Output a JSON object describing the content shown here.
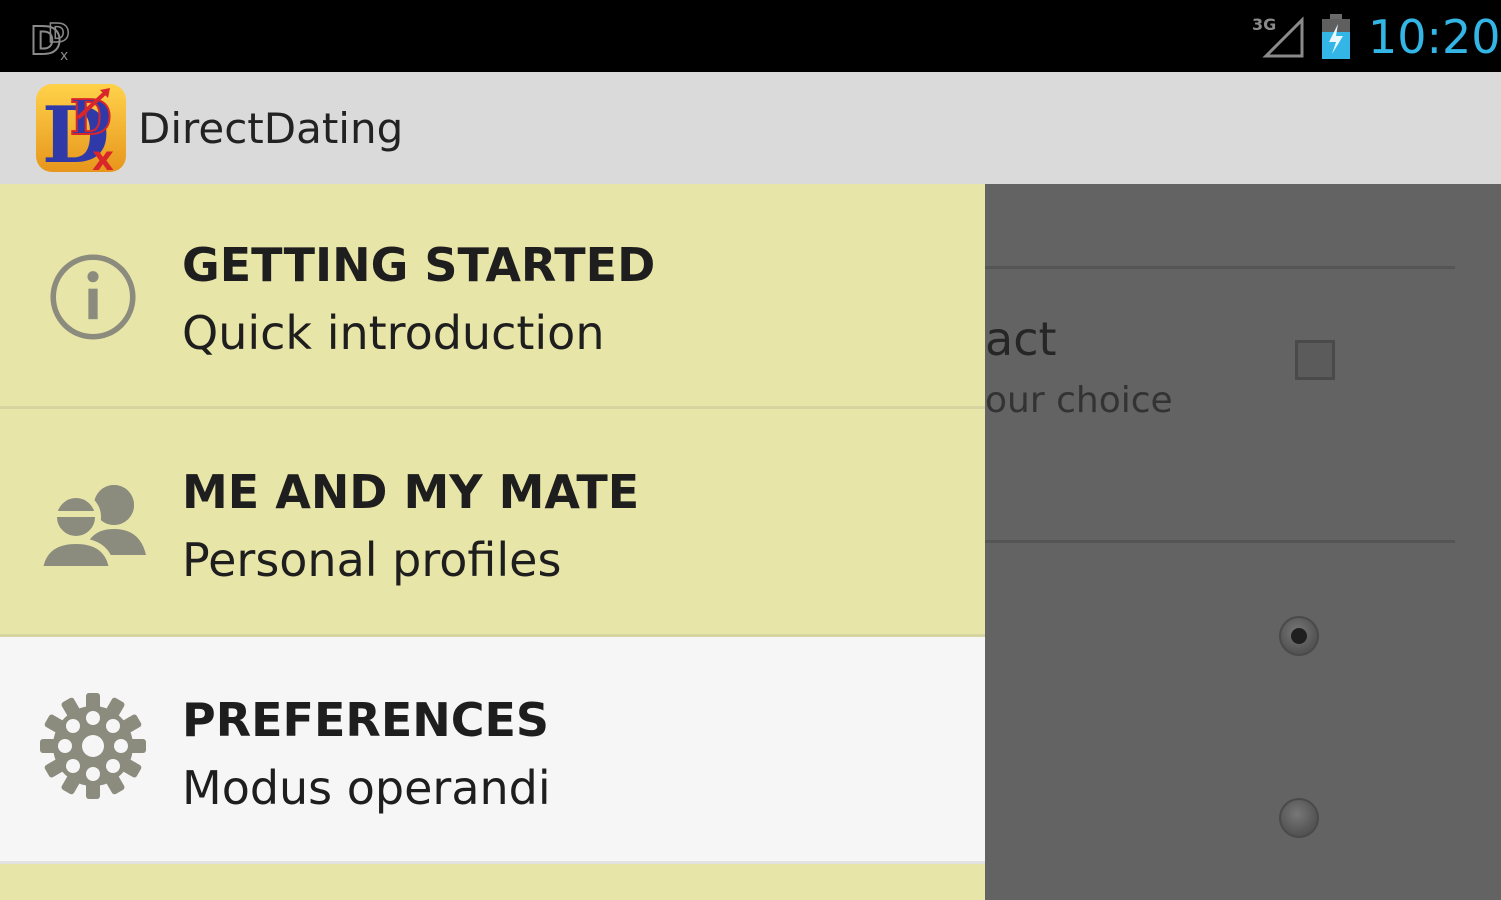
{
  "status_bar": {
    "network_label": "3G",
    "time": "10:20",
    "time_color": "#33b5e5",
    "icons": [
      "app-notification-icon",
      "signal-icon",
      "battery-charging-icon"
    ]
  },
  "action_bar": {
    "title": "DirectDating",
    "logo_icon": "directdating-logo-icon"
  },
  "drawer": {
    "items": [
      {
        "title": "GETTING STARTED",
        "subtitle": "Quick introduction",
        "icon": "info-icon",
        "selected": false
      },
      {
        "title": "ME AND MY MATE",
        "subtitle": "Personal profiles",
        "icon": "people-icon",
        "selected": false
      },
      {
        "title": "PREFERENCES",
        "subtitle": "Modus operandi",
        "icon": "gear-icon",
        "selected": true
      }
    ],
    "background_color": "#e8e5a8",
    "selected_color": "#f6f6f6"
  },
  "background_content": {
    "setting_title_visible": "act",
    "setting_subtitle_visible": "our choice",
    "checkbox_checked": false,
    "radio_options": [
      {
        "checked": true
      },
      {
        "checked": false
      }
    ]
  }
}
